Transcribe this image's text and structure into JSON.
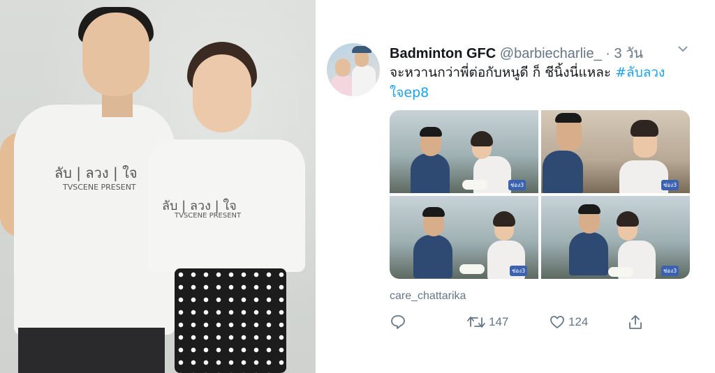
{
  "photo": {
    "shirt_logo_text": "ลับ | ลวง | ใจ",
    "shirt_sub_text": "TVSCENE PRESENT"
  },
  "tweet": {
    "display_name": "Badminton GFC",
    "handle": "@barbiecharlie_",
    "separator": "·",
    "time": "3 วัน",
    "text": "จะหวานกว่าพี่ต่อกับหนูดี ก็ ชีนิ้งนี่แหละ ",
    "hashtag": "#ลับลวงใจep8",
    "media_logo": "ช่อง3",
    "credit": "care_chattarika",
    "actions": {
      "reply_icon": "reply-icon",
      "retweet_icon": "retweet-icon",
      "retweet_count": "147",
      "like_icon": "heart-icon",
      "like_count": "124",
      "share_icon": "share-icon"
    },
    "colors": {
      "name": "#14171a",
      "secondary": "#657786",
      "link": "#1da1f2"
    }
  }
}
